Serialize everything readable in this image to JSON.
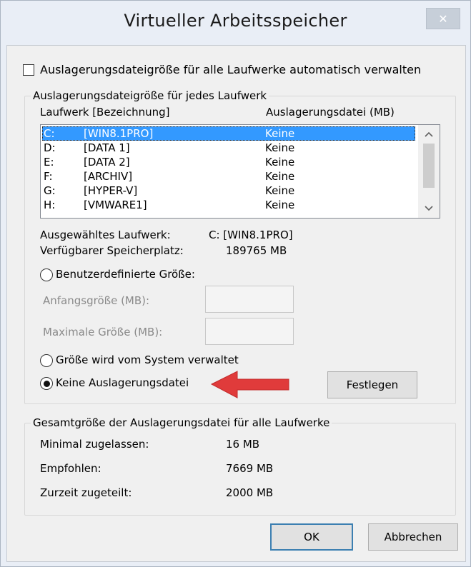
{
  "window": {
    "title": "Virtueller Arbeitsspeicher",
    "close_glyph": "✕"
  },
  "auto_manage": {
    "label": "Auslagerungsdateigröße für alle Laufwerke automatisch verwalten",
    "checked": false
  },
  "drive_group": {
    "legend": "Auslagerungsdateigröße für jedes Laufwerk",
    "col_drive": "Laufwerk [Bezeichnung]",
    "col_pagefile": "Auslagerungsdatei (MB)",
    "drives": [
      {
        "letter": "C:",
        "label": "[WIN8.1PRO]",
        "pagefile": "Keine",
        "selected": true
      },
      {
        "letter": "D:",
        "label": "[DATA 1]",
        "pagefile": "Keine",
        "selected": false
      },
      {
        "letter": "E:",
        "label": "[DATA 2]",
        "pagefile": "Keine",
        "selected": false
      },
      {
        "letter": "F:",
        "label": "[ARCHIV]",
        "pagefile": "Keine",
        "selected": false
      },
      {
        "letter": "G:",
        "label": "[HYPER-V]",
        "pagefile": "Keine",
        "selected": false
      },
      {
        "letter": "H:",
        "label": "[VMWARE1]",
        "pagefile": "Keine",
        "selected": false
      }
    ],
    "selected_label": "Ausgewähltes Laufwerk:",
    "selected_value": "C:  [WIN8.1PRO]",
    "free_label": "Verfügbarer Speicherplatz:",
    "free_value": "189765 MB",
    "custom_size_label": "Benutzerdefinierte Größe:",
    "initial_label": "Anfangsgröße (MB):",
    "initial_value": "",
    "max_label": "Maximale Größe (MB):",
    "max_value": "",
    "system_managed_label": "Größe wird vom System verwaltet",
    "no_pagefile_label": "Keine Auslagerungsdatei",
    "selected_option": "no_pagefile",
    "set_button": "Festlegen"
  },
  "total_group": {
    "legend": "Gesamtgröße der Auslagerungsdatei für alle Laufwerke",
    "min_label": "Minimal zugelassen:",
    "min_value": "16 MB",
    "rec_label": "Empfohlen:",
    "rec_value": "7669 MB",
    "cur_label": "Zurzeit zugeteilt:",
    "cur_value": "2000 MB"
  },
  "buttons": {
    "ok": "OK",
    "cancel": "Abbrechen"
  },
  "colors": {
    "selection": "#3399ff",
    "arrow": "#e03b3b",
    "default_button_border": "#3c7fb1"
  }
}
